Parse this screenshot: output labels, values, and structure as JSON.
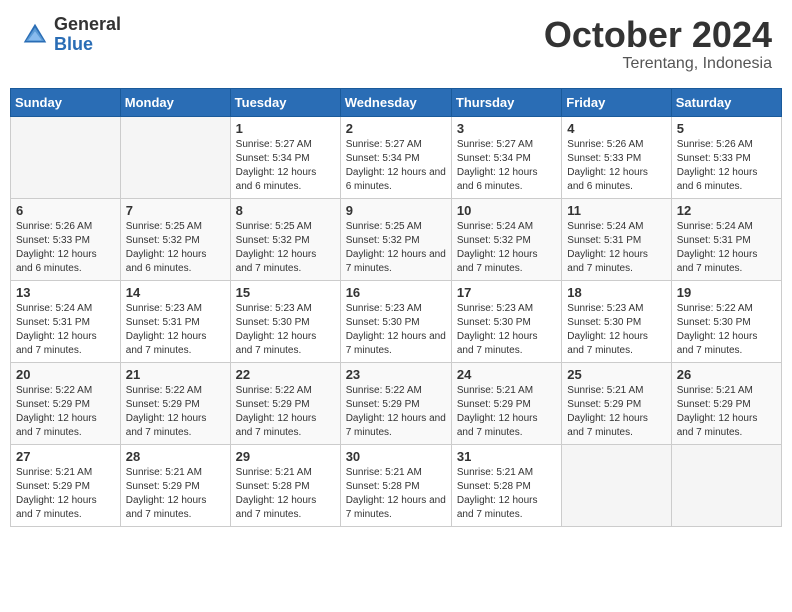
{
  "logo": {
    "general": "General",
    "blue": "Blue"
  },
  "header": {
    "month": "October 2024",
    "location": "Terentang, Indonesia"
  },
  "weekdays": [
    "Sunday",
    "Monday",
    "Tuesday",
    "Wednesday",
    "Thursday",
    "Friday",
    "Saturday"
  ],
  "weeks": [
    [
      {
        "day": "",
        "info": ""
      },
      {
        "day": "",
        "info": ""
      },
      {
        "day": "1",
        "info": "Sunrise: 5:27 AM\nSunset: 5:34 PM\nDaylight: 12 hours and 6 minutes."
      },
      {
        "day": "2",
        "info": "Sunrise: 5:27 AM\nSunset: 5:34 PM\nDaylight: 12 hours and 6 minutes."
      },
      {
        "day": "3",
        "info": "Sunrise: 5:27 AM\nSunset: 5:34 PM\nDaylight: 12 hours and 6 minutes."
      },
      {
        "day": "4",
        "info": "Sunrise: 5:26 AM\nSunset: 5:33 PM\nDaylight: 12 hours and 6 minutes."
      },
      {
        "day": "5",
        "info": "Sunrise: 5:26 AM\nSunset: 5:33 PM\nDaylight: 12 hours and 6 minutes."
      }
    ],
    [
      {
        "day": "6",
        "info": "Sunrise: 5:26 AM\nSunset: 5:33 PM\nDaylight: 12 hours and 6 minutes."
      },
      {
        "day": "7",
        "info": "Sunrise: 5:25 AM\nSunset: 5:32 PM\nDaylight: 12 hours and 6 minutes."
      },
      {
        "day": "8",
        "info": "Sunrise: 5:25 AM\nSunset: 5:32 PM\nDaylight: 12 hours and 7 minutes."
      },
      {
        "day": "9",
        "info": "Sunrise: 5:25 AM\nSunset: 5:32 PM\nDaylight: 12 hours and 7 minutes."
      },
      {
        "day": "10",
        "info": "Sunrise: 5:24 AM\nSunset: 5:32 PM\nDaylight: 12 hours and 7 minutes."
      },
      {
        "day": "11",
        "info": "Sunrise: 5:24 AM\nSunset: 5:31 PM\nDaylight: 12 hours and 7 minutes."
      },
      {
        "day": "12",
        "info": "Sunrise: 5:24 AM\nSunset: 5:31 PM\nDaylight: 12 hours and 7 minutes."
      }
    ],
    [
      {
        "day": "13",
        "info": "Sunrise: 5:24 AM\nSunset: 5:31 PM\nDaylight: 12 hours and 7 minutes."
      },
      {
        "day": "14",
        "info": "Sunrise: 5:23 AM\nSunset: 5:31 PM\nDaylight: 12 hours and 7 minutes."
      },
      {
        "day": "15",
        "info": "Sunrise: 5:23 AM\nSunset: 5:30 PM\nDaylight: 12 hours and 7 minutes."
      },
      {
        "day": "16",
        "info": "Sunrise: 5:23 AM\nSunset: 5:30 PM\nDaylight: 12 hours and 7 minutes."
      },
      {
        "day": "17",
        "info": "Sunrise: 5:23 AM\nSunset: 5:30 PM\nDaylight: 12 hours and 7 minutes."
      },
      {
        "day": "18",
        "info": "Sunrise: 5:23 AM\nSunset: 5:30 PM\nDaylight: 12 hours and 7 minutes."
      },
      {
        "day": "19",
        "info": "Sunrise: 5:22 AM\nSunset: 5:30 PM\nDaylight: 12 hours and 7 minutes."
      }
    ],
    [
      {
        "day": "20",
        "info": "Sunrise: 5:22 AM\nSunset: 5:29 PM\nDaylight: 12 hours and 7 minutes."
      },
      {
        "day": "21",
        "info": "Sunrise: 5:22 AM\nSunset: 5:29 PM\nDaylight: 12 hours and 7 minutes."
      },
      {
        "day": "22",
        "info": "Sunrise: 5:22 AM\nSunset: 5:29 PM\nDaylight: 12 hours and 7 minutes."
      },
      {
        "day": "23",
        "info": "Sunrise: 5:22 AM\nSunset: 5:29 PM\nDaylight: 12 hours and 7 minutes."
      },
      {
        "day": "24",
        "info": "Sunrise: 5:21 AM\nSunset: 5:29 PM\nDaylight: 12 hours and 7 minutes."
      },
      {
        "day": "25",
        "info": "Sunrise: 5:21 AM\nSunset: 5:29 PM\nDaylight: 12 hours and 7 minutes."
      },
      {
        "day": "26",
        "info": "Sunrise: 5:21 AM\nSunset: 5:29 PM\nDaylight: 12 hours and 7 minutes."
      }
    ],
    [
      {
        "day": "27",
        "info": "Sunrise: 5:21 AM\nSunset: 5:29 PM\nDaylight: 12 hours and 7 minutes."
      },
      {
        "day": "28",
        "info": "Sunrise: 5:21 AM\nSunset: 5:29 PM\nDaylight: 12 hours and 7 minutes."
      },
      {
        "day": "29",
        "info": "Sunrise: 5:21 AM\nSunset: 5:28 PM\nDaylight: 12 hours and 7 minutes."
      },
      {
        "day": "30",
        "info": "Sunrise: 5:21 AM\nSunset: 5:28 PM\nDaylight: 12 hours and 7 minutes."
      },
      {
        "day": "31",
        "info": "Sunrise: 5:21 AM\nSunset: 5:28 PM\nDaylight: 12 hours and 7 minutes."
      },
      {
        "day": "",
        "info": ""
      },
      {
        "day": "",
        "info": ""
      }
    ]
  ]
}
